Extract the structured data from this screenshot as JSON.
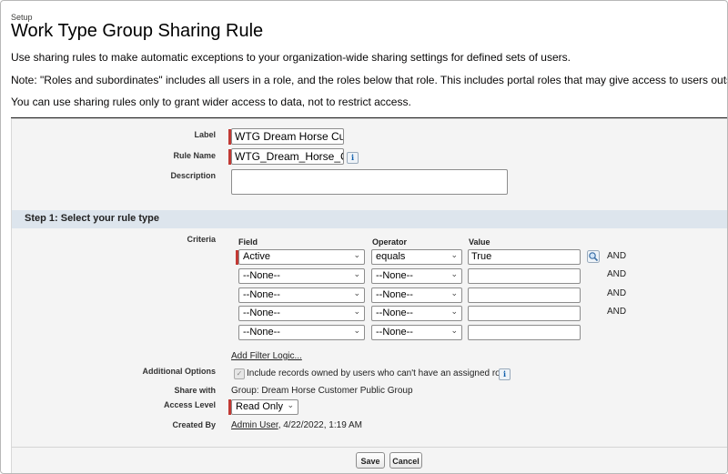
{
  "header": {
    "setup_label": "Setup",
    "page_title": "Work Type Group Sharing Rule"
  },
  "intro": {
    "line1": "Use sharing rules to make automatic exceptions to your organization-wide sharing settings for defined sets of users.",
    "line2": "Note: \"Roles and subordinates\" includes all users in a role, and the roles below that role. This includes portal roles that may give access to users outside the organization.",
    "line3": "You can use sharing rules only to grant wider access to data, not to restrict access."
  },
  "form": {
    "label_label": "Label",
    "label_value": "WTG Dream Horse Cus",
    "rule_name_label": "Rule Name",
    "rule_name_value": "WTG_Dream_Horse_C",
    "description_label": "Description",
    "description_value": ""
  },
  "step1": {
    "title": "Step 1: Select your rule type",
    "criteria_label": "Criteria",
    "headers": {
      "field": "Field",
      "operator": "Operator",
      "value": "Value"
    },
    "rows": [
      {
        "field": "Active",
        "operator": "equals",
        "value": "True",
        "and": "AND"
      },
      {
        "field": "--None--",
        "operator": "--None--",
        "value": "",
        "and": "AND"
      },
      {
        "field": "--None--",
        "operator": "--None--",
        "value": "",
        "and": "AND"
      },
      {
        "field": "--None--",
        "operator": "--None--",
        "value": "",
        "and": "AND"
      },
      {
        "field": "--None--",
        "operator": "--None--",
        "value": "",
        "and": ""
      }
    ],
    "add_filter_logic": "Add Filter Logic..."
  },
  "options": {
    "additional_options_label": "Additional Options",
    "checkbox_text": "Include records owned by users who can't have an assigned role",
    "share_with_label": "Share with",
    "share_with_value": "Group: Dream Horse Customer Public Group",
    "access_level_label": "Access Level",
    "access_level_value": "Read Only",
    "created_by_label": "Created By",
    "created_by_user": "Admin User",
    "created_by_date": ", 4/22/2022, 1:19 AM"
  },
  "buttons": {
    "save": "Save",
    "cancel": "Cancel"
  },
  "colors": {
    "required": "#c23934",
    "section_bar": "#dde5ed",
    "panel": "#f4f4f4"
  }
}
